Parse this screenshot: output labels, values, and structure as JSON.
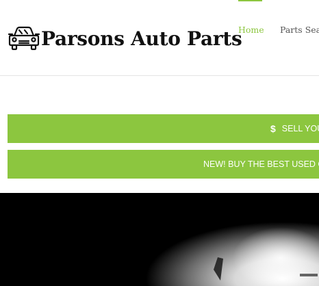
{
  "brand": {
    "name": "Parsons Auto Parts",
    "icon": "car-front-icon"
  },
  "nav": {
    "items": [
      {
        "label": "Home",
        "active": true
      },
      {
        "label": "Parts Sear"
      }
    ]
  },
  "banners": [
    {
      "icon": "dollar-icon",
      "label": "SELL YOU"
    },
    {
      "label": "NEW! BUY THE BEST USED C"
    }
  ],
  "colors": {
    "accent": "#8cc63f",
    "text": "#111111",
    "nav_text": "#555555",
    "hero_bg": "#000000"
  }
}
